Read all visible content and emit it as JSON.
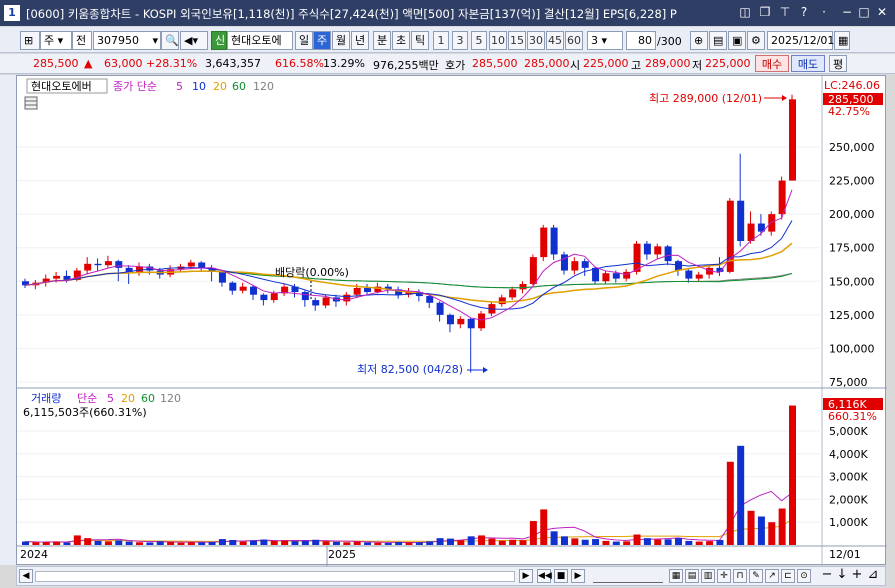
{
  "window": {
    "index": "1",
    "title": "[0600] 키움종합차트 - KOSPI 외국인보유[1,118(천)] 주식수[27,424(천)] 액면[500] 자본금[137(억)] 결산[12월] EPS[6,228] P"
  },
  "toolbar": {
    "type1": "주",
    "type2": "전",
    "code": "307950",
    "credit_badge": "신",
    "name": "현대오토에",
    "periods": [
      "일",
      "주",
      "월",
      "년",
      "분",
      "초",
      "틱"
    ],
    "selected_period": "주",
    "minutes": [
      "1",
      "3",
      "5",
      "10",
      "15",
      "30",
      "45",
      "60"
    ],
    "minute_select": "3",
    "count": "80",
    "count_total": "/300",
    "date": "2025/12/01"
  },
  "quote": {
    "price": "285,500",
    "up_icon": "up-triangle",
    "change": "63,000",
    "change_pct": "+28.31%",
    "volume": "3,643,357",
    "volume_ratio": "616.58%",
    "turnover": "13.29%",
    "amount": "976,255백만",
    "ask_label": "호가",
    "ask1": "285,500",
    "ask2": "285,000",
    "open_label": "시",
    "open": "225,000",
    "high_label": "고",
    "high": "289,000",
    "low_label": "저",
    "low": "225,000",
    "buy_label": "매수",
    "sell_label": "매도",
    "eval_label": "평"
  },
  "price_panel": {
    "stock_label": "현대오토에버",
    "ma_label": "종가 단순",
    "ma_periods": [
      "5",
      "10",
      "20",
      "60",
      "120"
    ],
    "lc_label": "LC:246.06",
    "current_badge": "285,500",
    "current_pct": "42.75%",
    "high_annotation": "최고 289,000 (12/01)",
    "low_annotation": "최저 82,500 (04/28)",
    "dividend_annotation": "배당락(0.00%)",
    "y_ticks": [
      "250,000",
      "225,000",
      "200,000",
      "175,000",
      "150,000",
      "125,000",
      "100,000",
      "75,000"
    ]
  },
  "volume_panel": {
    "label": "거래량",
    "ma_label": "단순",
    "ma_periods": [
      "5",
      "20",
      "60",
      "120"
    ],
    "current_info": "6,115,503주(660.31%)",
    "current_badge": "6,116K",
    "current_pct": "660.31%",
    "y_ticks": [
      "5,000K",
      "4,000K",
      "3,000K",
      "2,000K",
      "1,000K"
    ]
  },
  "x_axis": {
    "labels": [
      "2024",
      "2025"
    ],
    "right_label": "12/01"
  },
  "colors": {
    "up": "#e00000",
    "down": "#1030d0",
    "ma5": "#c020c0",
    "ma10": "#1030d0",
    "ma20": "#e0a000",
    "ma60": "#109030",
    "ma120": "#808080"
  }
}
